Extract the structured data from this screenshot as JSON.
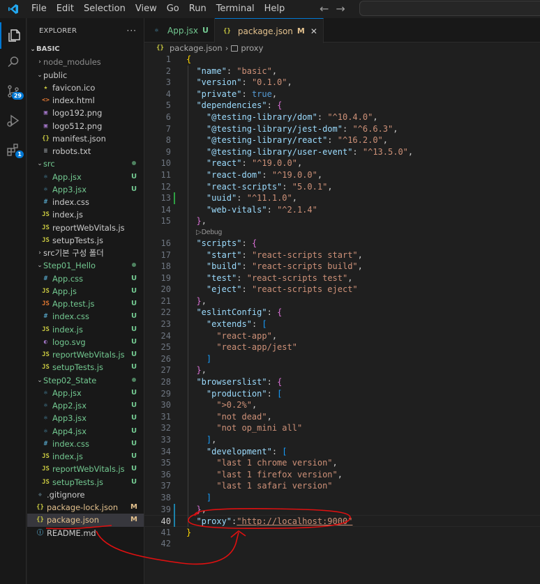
{
  "menu": [
    "File",
    "Edit",
    "Selection",
    "View",
    "Go",
    "Run",
    "Terminal",
    "Help"
  ],
  "activity": {
    "scm_badge": "29",
    "extensions_badge": "1"
  },
  "explorer": {
    "title": "EXPLORER",
    "more": "···",
    "root": "BASIC",
    "rows": [
      {
        "name": "node_modules",
        "kind": "folder",
        "chev": "›",
        "depth": 1,
        "color": "ignored",
        "status": ""
      },
      {
        "name": "public",
        "kind": "folder",
        "chev": "⌄",
        "depth": 1,
        "color": "normal",
        "status": ""
      },
      {
        "name": "favicon.ico",
        "kind": "star",
        "depth": 2,
        "color": "normal",
        "status": ""
      },
      {
        "name": "index.html",
        "kind": "html",
        "depth": 2,
        "color": "normal",
        "status": ""
      },
      {
        "name": "logo192.png",
        "kind": "img",
        "depth": 2,
        "color": "normal",
        "status": ""
      },
      {
        "name": "logo512.png",
        "kind": "img",
        "depth": 2,
        "color": "normal",
        "status": ""
      },
      {
        "name": "manifest.json",
        "kind": "json",
        "depth": 2,
        "color": "normal",
        "status": ""
      },
      {
        "name": "robots.txt",
        "kind": "txt",
        "depth": 2,
        "color": "normal",
        "status": ""
      },
      {
        "name": "src",
        "kind": "folder",
        "chev": "⌄",
        "depth": 1,
        "color": "green",
        "status": "dot"
      },
      {
        "name": "App.jsx",
        "kind": "react",
        "depth": 2,
        "color": "green",
        "status": "U"
      },
      {
        "name": "App3.jsx",
        "kind": "react",
        "depth": 2,
        "color": "green",
        "status": "U"
      },
      {
        "name": "index.css",
        "kind": "css",
        "depth": 2,
        "color": "normal",
        "status": ""
      },
      {
        "name": "index.js",
        "kind": "js",
        "depth": 2,
        "color": "normal",
        "status": ""
      },
      {
        "name": "reportWebVitals.js",
        "kind": "js",
        "depth": 2,
        "color": "normal",
        "status": ""
      },
      {
        "name": "setupTests.js",
        "kind": "js",
        "depth": 2,
        "color": "normal",
        "status": ""
      },
      {
        "name": "src기본 구성 폴더",
        "kind": "folder",
        "chev": "›",
        "depth": 1,
        "color": "normal",
        "status": ""
      },
      {
        "name": "Step01_Hello",
        "kind": "folder",
        "chev": "⌄",
        "depth": 1,
        "color": "green",
        "status": "dot"
      },
      {
        "name": "App.css",
        "kind": "css",
        "depth": 2,
        "color": "green",
        "status": "U"
      },
      {
        "name": "App.js",
        "kind": "js",
        "depth": 2,
        "color": "green",
        "status": "U"
      },
      {
        "name": "App.test.js",
        "kind": "test",
        "depth": 2,
        "color": "green",
        "status": "U"
      },
      {
        "name": "index.css",
        "kind": "css",
        "depth": 2,
        "color": "green",
        "status": "U"
      },
      {
        "name": "index.js",
        "kind": "js",
        "depth": 2,
        "color": "green",
        "status": "U"
      },
      {
        "name": "logo.svg",
        "kind": "svg",
        "depth": 2,
        "color": "green",
        "status": "U"
      },
      {
        "name": "reportWebVitals.js",
        "kind": "js",
        "depth": 2,
        "color": "green",
        "status": "U"
      },
      {
        "name": "setupTests.js",
        "kind": "js",
        "depth": 2,
        "color": "green",
        "status": "U"
      },
      {
        "name": "Step02_State",
        "kind": "folder",
        "chev": "⌄",
        "depth": 1,
        "color": "green",
        "status": "dot"
      },
      {
        "name": "App.jsx",
        "kind": "react",
        "depth": 2,
        "color": "green",
        "status": "U"
      },
      {
        "name": "App2.jsx",
        "kind": "react",
        "depth": 2,
        "color": "green",
        "status": "U"
      },
      {
        "name": "App3.jsx",
        "kind": "react",
        "depth": 2,
        "color": "green",
        "status": "U"
      },
      {
        "name": "App4.jsx",
        "kind": "react",
        "depth": 2,
        "color": "green",
        "status": "U"
      },
      {
        "name": "index.css",
        "kind": "css",
        "depth": 2,
        "color": "green",
        "status": "U"
      },
      {
        "name": "index.js",
        "kind": "js",
        "depth": 2,
        "color": "green",
        "status": "U"
      },
      {
        "name": "reportWebVitals.js",
        "kind": "js",
        "depth": 2,
        "color": "green",
        "status": "U"
      },
      {
        "name": "setupTests.js",
        "kind": "js",
        "depth": 2,
        "color": "green",
        "status": "U"
      },
      {
        "name": ".gitignore",
        "kind": "git",
        "depth": 1,
        "color": "normal",
        "status": ""
      },
      {
        "name": "package-lock.json",
        "kind": "json",
        "depth": 1,
        "color": "mod",
        "status": "M"
      },
      {
        "name": "package.json",
        "kind": "json",
        "depth": 1,
        "color": "mod",
        "status": "M",
        "selected": true
      },
      {
        "name": "README.md",
        "kind": "info",
        "depth": 1,
        "color": "normal",
        "status": ""
      }
    ]
  },
  "tabs": [
    {
      "label": "App.jsx",
      "status": "U",
      "icon": "react",
      "active": false
    },
    {
      "label": "package.json",
      "status": "M",
      "icon": "json",
      "active": true
    }
  ],
  "breadcrumb": {
    "file": "package.json",
    "symbol": "proxy",
    "separator": "›"
  },
  "codelens": "▷Debug",
  "code": [
    [
      [
        "{",
        "p1"
      ]
    ],
    [
      [
        "  "
      ],
      [
        "\"name\"",
        "k"
      ],
      [
        ": ",
        "pu"
      ],
      [
        "\"basic\"",
        "s"
      ],
      [
        ",",
        "pu"
      ]
    ],
    [
      [
        "  "
      ],
      [
        "\"version\"",
        "k"
      ],
      [
        ": ",
        "pu"
      ],
      [
        "\"0.1.0\"",
        "s"
      ],
      [
        ",",
        "pu"
      ]
    ],
    [
      [
        "  "
      ],
      [
        "\"private\"",
        "k"
      ],
      [
        ": ",
        "pu"
      ],
      [
        "true",
        "b"
      ],
      [
        ",",
        "pu"
      ]
    ],
    [
      [
        "  "
      ],
      [
        "\"dependencies\"",
        "k"
      ],
      [
        ": ",
        "pu"
      ],
      [
        "{",
        "p2"
      ]
    ],
    [
      [
        "    "
      ],
      [
        "\"@testing-library/dom\"",
        "k"
      ],
      [
        ": ",
        "pu"
      ],
      [
        "\"^10.4.0\"",
        "s"
      ],
      [
        ",",
        "pu"
      ]
    ],
    [
      [
        "    "
      ],
      [
        "\"@testing-library/jest-dom\"",
        "k"
      ],
      [
        ": ",
        "pu"
      ],
      [
        "\"^6.6.3\"",
        "s"
      ],
      [
        ",",
        "pu"
      ]
    ],
    [
      [
        "    "
      ],
      [
        "\"@testing-library/react\"",
        "k"
      ],
      [
        ": ",
        "pu"
      ],
      [
        "\"^16.2.0\"",
        "s"
      ],
      [
        ",",
        "pu"
      ]
    ],
    [
      [
        "    "
      ],
      [
        "\"@testing-library/user-event\"",
        "k"
      ],
      [
        ": ",
        "pu"
      ],
      [
        "\"^13.5.0\"",
        "s"
      ],
      [
        ",",
        "pu"
      ]
    ],
    [
      [
        "    "
      ],
      [
        "\"react\"",
        "k"
      ],
      [
        ": ",
        "pu"
      ],
      [
        "\"^19.0.0\"",
        "s"
      ],
      [
        ",",
        "pu"
      ]
    ],
    [
      [
        "    "
      ],
      [
        "\"react-dom\"",
        "k"
      ],
      [
        ": ",
        "pu"
      ],
      [
        "\"^19.0.0\"",
        "s"
      ],
      [
        ",",
        "pu"
      ]
    ],
    [
      [
        "    "
      ],
      [
        "\"react-scripts\"",
        "k"
      ],
      [
        ": ",
        "pu"
      ],
      [
        "\"5.0.1\"",
        "s"
      ],
      [
        ",",
        "pu"
      ]
    ],
    [
      [
        "    "
      ],
      [
        "\"uuid\"",
        "k"
      ],
      [
        ": ",
        "pu"
      ],
      [
        "\"^11.1.0\"",
        "s"
      ],
      [
        ",",
        "pu"
      ]
    ],
    [
      [
        "    "
      ],
      [
        "\"web-vitals\"",
        "k"
      ],
      [
        ": ",
        "pu"
      ],
      [
        "\"^2.1.4\"",
        "s"
      ]
    ],
    [
      [
        "  "
      ],
      [
        "}",
        "p2"
      ],
      [
        ",",
        "pu"
      ]
    ],
    [
      [
        "  "
      ],
      [
        "\"scripts\"",
        "k"
      ],
      [
        ": ",
        "pu"
      ],
      [
        "{",
        "p2"
      ]
    ],
    [
      [
        "    "
      ],
      [
        "\"start\"",
        "k"
      ],
      [
        ": ",
        "pu"
      ],
      [
        "\"react-scripts start\"",
        "s"
      ],
      [
        ",",
        "pu"
      ]
    ],
    [
      [
        "    "
      ],
      [
        "\"build\"",
        "k"
      ],
      [
        ": ",
        "pu"
      ],
      [
        "\"react-scripts build\"",
        "s"
      ],
      [
        ",",
        "pu"
      ]
    ],
    [
      [
        "    "
      ],
      [
        "\"test\"",
        "k"
      ],
      [
        ": ",
        "pu"
      ],
      [
        "\"react-scripts test\"",
        "s"
      ],
      [
        ",",
        "pu"
      ]
    ],
    [
      [
        "    "
      ],
      [
        "\"eject\"",
        "k"
      ],
      [
        ": ",
        "pu"
      ],
      [
        "\"react-scripts eject\"",
        "s"
      ]
    ],
    [
      [
        "  "
      ],
      [
        "}",
        "p2"
      ],
      [
        ",",
        "pu"
      ]
    ],
    [
      [
        "  "
      ],
      [
        "\"eslintConfig\"",
        "k"
      ],
      [
        ": ",
        "pu"
      ],
      [
        "{",
        "p2"
      ]
    ],
    [
      [
        "    "
      ],
      [
        "\"extends\"",
        "k"
      ],
      [
        ": ",
        "pu"
      ],
      [
        "[",
        "p3"
      ]
    ],
    [
      [
        "      "
      ],
      [
        "\"react-app\"",
        "s"
      ],
      [
        ",",
        "pu"
      ]
    ],
    [
      [
        "      "
      ],
      [
        "\"react-app/jest\"",
        "s"
      ]
    ],
    [
      [
        "    "
      ],
      [
        "]",
        "p3"
      ]
    ],
    [
      [
        "  "
      ],
      [
        "}",
        "p2"
      ],
      [
        ",",
        "pu"
      ]
    ],
    [
      [
        "  "
      ],
      [
        "\"browserslist\"",
        "k"
      ],
      [
        ": ",
        "pu"
      ],
      [
        "{",
        "p2"
      ]
    ],
    [
      [
        "    "
      ],
      [
        "\"production\"",
        "k"
      ],
      [
        ": ",
        "pu"
      ],
      [
        "[",
        "p3"
      ]
    ],
    [
      [
        "      "
      ],
      [
        "\">0.2%\"",
        "s"
      ],
      [
        ",",
        "pu"
      ]
    ],
    [
      [
        "      "
      ],
      [
        "\"not dead\"",
        "s"
      ],
      [
        ",",
        "pu"
      ]
    ],
    [
      [
        "      "
      ],
      [
        "\"not op_mini all\"",
        "s"
      ]
    ],
    [
      [
        "    "
      ],
      [
        "]",
        "p3"
      ],
      [
        ",",
        "pu"
      ]
    ],
    [
      [
        "    "
      ],
      [
        "\"development\"",
        "k"
      ],
      [
        ": ",
        "pu"
      ],
      [
        "[",
        "p3"
      ]
    ],
    [
      [
        "      "
      ],
      [
        "\"last 1 chrome version\"",
        "s"
      ],
      [
        ",",
        "pu"
      ]
    ],
    [
      [
        "      "
      ],
      [
        "\"last 1 firefox version\"",
        "s"
      ],
      [
        ",",
        "pu"
      ]
    ],
    [
      [
        "      "
      ],
      [
        "\"last 1 safari version\"",
        "s"
      ]
    ],
    [
      [
        "    "
      ],
      [
        "]",
        "p3"
      ]
    ],
    [
      [
        "  "
      ],
      [
        "}",
        "p2"
      ],
      [
        ",",
        "pu"
      ]
    ],
    [
      [
        "  "
      ],
      [
        "\"proxy\"",
        "k"
      ],
      [
        ":",
        "pu"
      ],
      [
        "\"http://localhost:9000\"",
        "s link"
      ]
    ],
    [
      [
        "}",
        "p1"
      ]
    ],
    [
      [
        ""
      ]
    ]
  ],
  "active_line": 40,
  "codelens_after_line": 15,
  "colors": {
    "accent": "#0078d4",
    "untracked": "#73c991",
    "modified": "#e2c08d",
    "annotation": "#e01010"
  }
}
